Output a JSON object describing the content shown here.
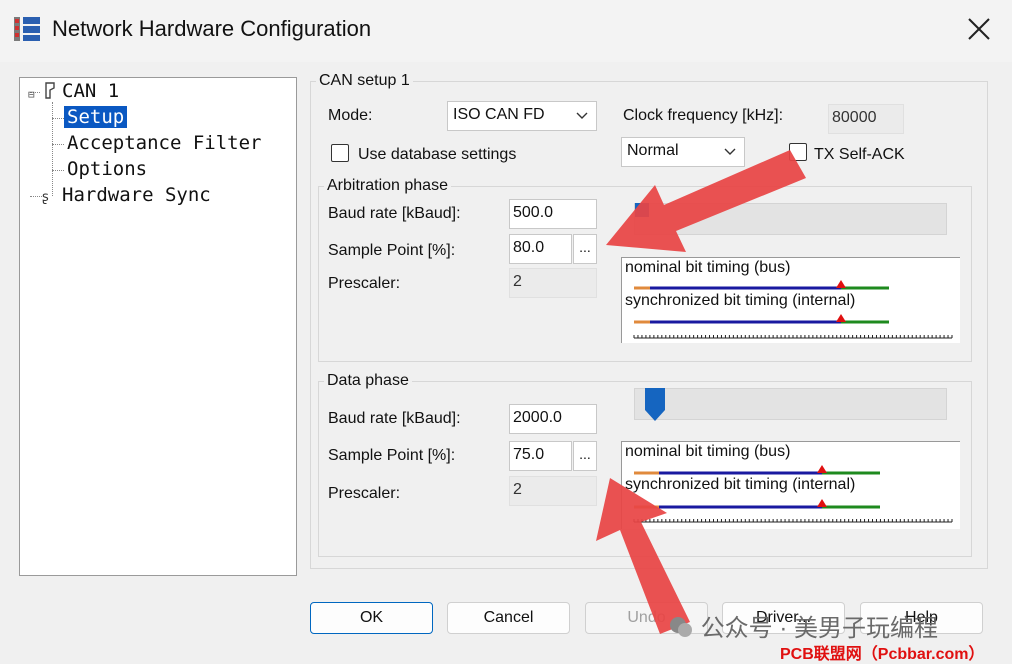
{
  "window": {
    "title": "Network Hardware Configuration"
  },
  "tree": {
    "can1": "CAN 1",
    "setup": "Setup",
    "acceptance_filter": "Acceptance Filter",
    "options": "Options",
    "hardware_sync": "Hardware Sync"
  },
  "setup": {
    "group_title": "CAN setup 1",
    "mode_label": "Mode:",
    "mode_value": "ISO CAN FD",
    "clock_label": "Clock frequency [kHz]:",
    "clock_value": "80000",
    "use_db_label": "Use database settings",
    "normal_value": "Normal",
    "tx_self_ack_label": "TX Self-ACK"
  },
  "arbitration": {
    "title": "Arbitration phase",
    "baud_label": "Baud rate [kBaud]:",
    "baud_value": "500.0",
    "sp_label": "Sample Point [%]:",
    "sp_value": "80.0",
    "dots": "...",
    "prescaler_label": "Prescaler:",
    "prescaler_value": "2",
    "nominal_label": "nominal bit timing (bus)",
    "sync_label": "synchronized bit timing (internal)",
    "slider_level": 0
  },
  "data_phase": {
    "title": "Data phase",
    "baud_label": "Baud rate [kBaud]:",
    "baud_value": "2000.0",
    "sp_label": "Sample Point [%]:",
    "sp_value": "75.0",
    "dots": "...",
    "prescaler_label": "Prescaler:",
    "prescaler_value": "2",
    "nominal_label": "nominal bit timing (bus)",
    "sync_label": "synchronized bit timing (internal)",
    "slider_level": 0.03
  },
  "buttons": {
    "ok": "OK",
    "cancel": "Cancel",
    "undo": "Undo",
    "driver": "Driver...",
    "help": "Help"
  },
  "watermark": {
    "wechat": "公众号 · 美男子玩编程",
    "site": "PCB联盟网（Pcbbar.com）"
  },
  "colors": {
    "accent": "#0a58c2",
    "arrow": "#e84545",
    "timing_blue": "#1a1aa0",
    "timing_green": "#1e8a1e",
    "timing_orange": "#e08a3c",
    "sample_red": "#e01010"
  }
}
